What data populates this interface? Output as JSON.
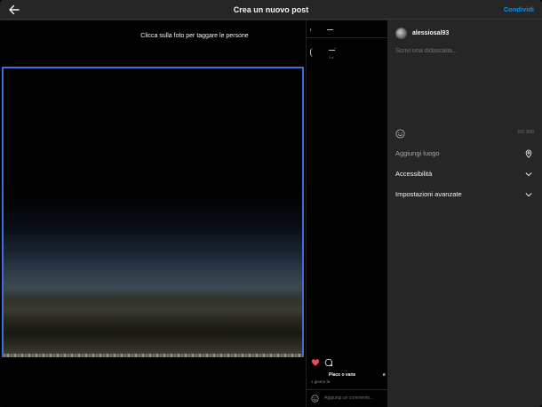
{
  "header": {
    "title": "Crea un nuovo post",
    "share_label": "Condividi"
  },
  "photo_area": {
    "tag_hint": "Clicca sulla foto per taggare le persone"
  },
  "preview": {
    "place_name": "Place o vane",
    "place_name_2": "e",
    "time_ago": "1 giorno fa",
    "comment_placeholder": "Aggiungi un commento...",
    "mini_time": "1 s"
  },
  "side": {
    "username": "alessiosal93",
    "caption_placeholder": "Scrivi una didascalia...",
    "char_count": "0/2.200",
    "add_location_label": "Aggiungi luogo",
    "accessibility_label": "Accessibilità",
    "advanced_label": "Impostazioni avanzate"
  },
  "colors": {
    "accent": "#0095f6",
    "like": "#ed4956",
    "selection_border": "#3a6fd8",
    "panel_bg": "#262626"
  },
  "icons": {
    "back": "arrow-left-icon",
    "emoji": "smiley-icon",
    "location": "map-pin-icon",
    "expand": "chevron-down-icon",
    "like": "heart-icon",
    "comment": "speech-bubble-icon"
  }
}
